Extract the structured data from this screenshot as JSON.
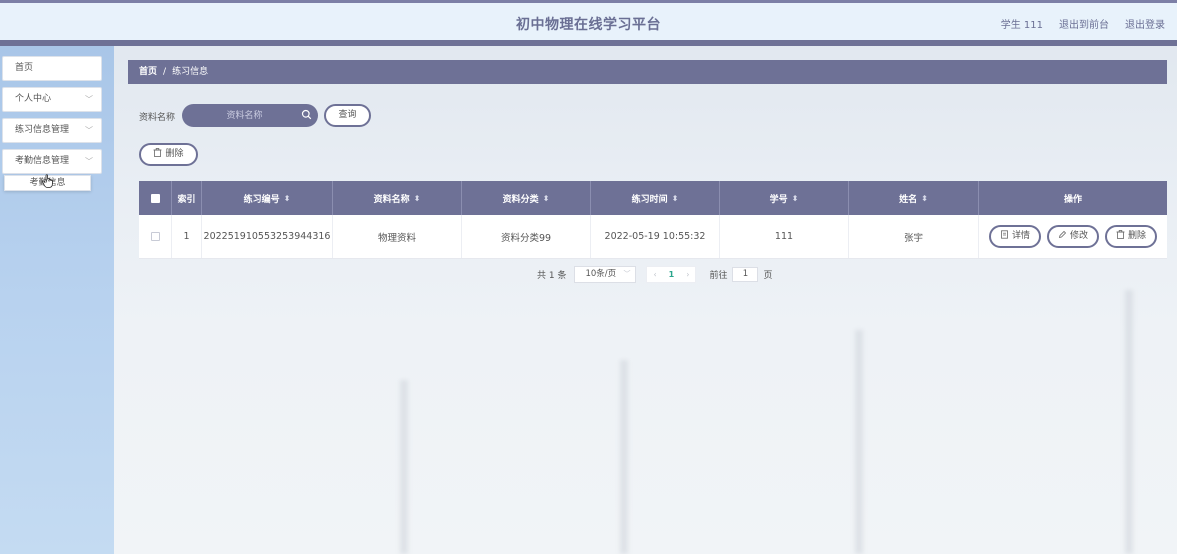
{
  "header": {
    "title": "初中物理在线学习平台",
    "user": "学生 111",
    "to_front": "退出到前台",
    "logout": "退出登录"
  },
  "sidebar": {
    "items": [
      {
        "label": "首页",
        "has_arrow": false
      },
      {
        "label": "个人中心",
        "has_arrow": true
      },
      {
        "label": "练习信息管理",
        "has_arrow": true
      },
      {
        "label": "考勤信息管理",
        "has_arrow": true
      }
    ],
    "submenu_item": "考勤信息"
  },
  "breadcrumb": {
    "home": "首页",
    "separator": "/",
    "current": "练习信息"
  },
  "search": {
    "label": "资料名称",
    "placeholder": "资料名称",
    "query_button": "查询"
  },
  "toolbar": {
    "delete_label": "删除"
  },
  "table": {
    "columns": [
      "索引",
      "练习编号",
      "资料名称",
      "资料分类",
      "练习时间",
      "学号",
      "姓名",
      "操作"
    ],
    "rows": [
      {
        "index": "1",
        "exercise_no": "202251910553253944316",
        "material_name": "物理资料",
        "material_category": "资料分类99",
        "exercise_time": "2022-05-19 10:55:32",
        "student_no": "111",
        "name": "张宇",
        "actions": [
          "详情",
          "修改",
          "删除"
        ]
      }
    ]
  },
  "pagination": {
    "total_text": "共 1 条",
    "page_size": "10条/页",
    "current_page": "1",
    "goto_label": "前往",
    "goto_value": "1",
    "page_suffix": "页"
  },
  "colors": {
    "primary": "#6e7196",
    "header_bg": "#e8f2fb",
    "sidebar_bg": "#b8d2ef",
    "active_page": "#2aa58c"
  }
}
